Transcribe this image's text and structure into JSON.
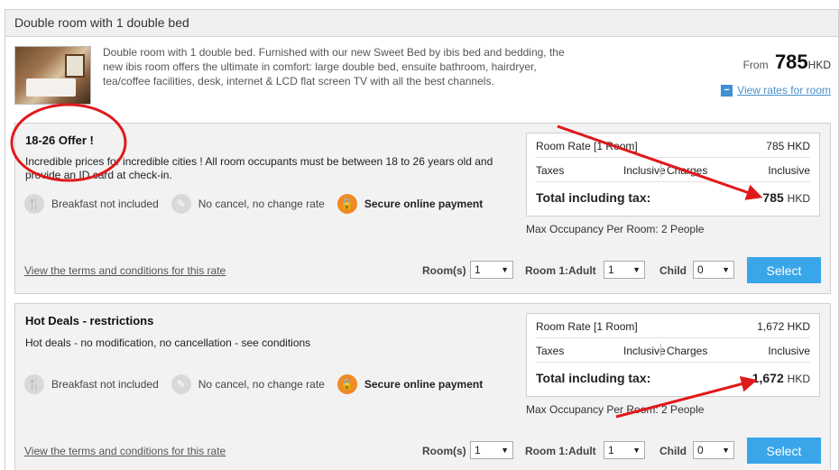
{
  "room": {
    "title": "Double room with 1 double bed",
    "description": "Double room with 1 double bed. Furnished with our new Sweet Bed by ibis bed and bedding, the new ibis room offers the ultimate in comfort: large double bed, ensuite bathroom, hairdryer, tea/coffee facilities, desk, internet & LCD flat screen TV with all the best channels.",
    "from_label": "From",
    "from_amount": "785",
    "from_currency": "HKD",
    "view_rates_label": "View rates for room"
  },
  "rates": [
    {
      "title": "18-26 Offer !",
      "description": "Incredible prices for incredible cities ! All room occupants must be between 18 to 26 years old and provide an ID card at check-in.",
      "features": [
        "Breakfast not included",
        "No cancel, no change rate",
        "Secure online payment"
      ],
      "room_rate_label": "Room Rate [1 Room]",
      "room_rate_value": "785 HKD",
      "taxes_label": "Taxes",
      "taxes_value": "Inclusive",
      "charges_label": "Charges",
      "charges_value": "Inclusive",
      "total_label": "Total including tax:",
      "total_amount": "785",
      "total_currency": "HKD",
      "max_occupancy": "Max Occupancy Per Room: 2 People",
      "terms_label": "View the terms and conditions for this rate",
      "rooms_label": "Room(s)",
      "rooms_value": "1",
      "adult_label": "Room 1:Adult",
      "adult_value": "1",
      "child_label": "Child",
      "child_value": "0",
      "select_label": "Select"
    },
    {
      "title": "Hot Deals - restrictions",
      "description": "Hot deals - no modification, no cancellation - see conditions",
      "features": [
        "Breakfast not included",
        "No cancel, no change rate",
        "Secure online payment"
      ],
      "room_rate_label": "Room Rate [1 Room]",
      "room_rate_value": "1,672 HKD",
      "taxes_label": "Taxes",
      "taxes_value": "Inclusive",
      "charges_label": "Charges",
      "charges_value": "Inclusive",
      "total_label": "Total including tax:",
      "total_amount": "1,672",
      "total_currency": "HKD",
      "max_occupancy": "Max Occupancy Per Room: 2 People",
      "terms_label": "View the terms and conditions for this rate",
      "rooms_label": "Room(s)",
      "rooms_value": "1",
      "adult_label": "Room 1:Adult",
      "adult_value": "1",
      "child_label": "Child",
      "child_value": "0",
      "select_label": "Select"
    }
  ],
  "icons": {
    "breakfast": "cutlery-icon",
    "cancel": "no-cancel-icon",
    "payment": "lock-icon",
    "view_rates": "minus-icon"
  },
  "colors": {
    "accent": "#39a6ea",
    "lock": "#f08a24",
    "annotation": "#e0191b",
    "link": "#4a90c8"
  }
}
